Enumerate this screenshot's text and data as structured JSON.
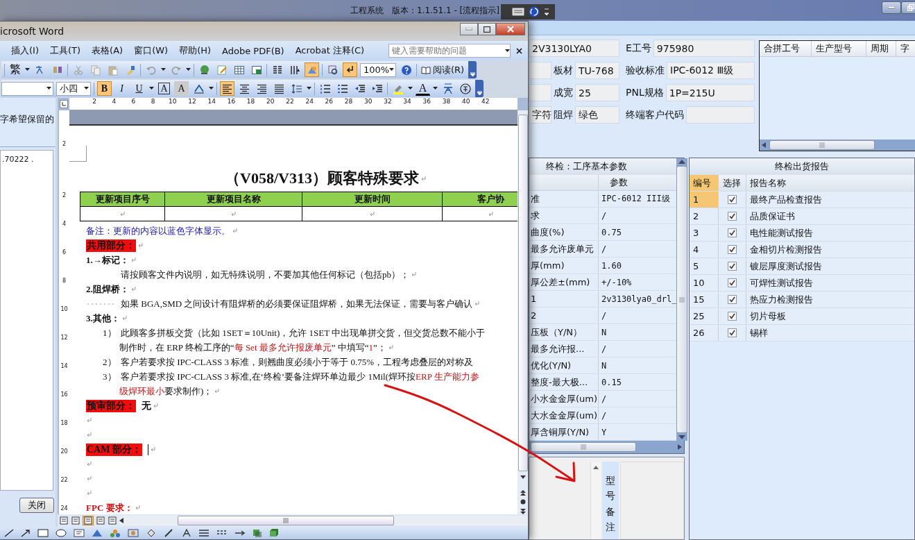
{
  "app_window": {
    "title": "工程系统　版本：1.1.51.1 - [流程指示]"
  },
  "form": {
    "left": [
      {
        "value": "2V3130LYA0"
      },
      {
        "kind": "split",
        "label": "板材",
        "value": "TU-768"
      },
      {
        "kind": "split",
        "label": "成宽",
        "value": "25"
      },
      {
        "kind": "split",
        "lead_value": "字符",
        "label": "阻焊",
        "value": "绿色"
      }
    ],
    "right": [
      {
        "label": "E工号",
        "value": "975980"
      },
      {
        "label": "验收标准",
        "value": "IPC-6012 Ⅲ级"
      },
      {
        "label": "PNL规格",
        "value": "1P=215U"
      },
      {
        "label": "终端客户代码"
      }
    ]
  },
  "merge_grid": {
    "columns": [
      "合拼工号",
      "生产型号",
      "周期",
      "字"
    ]
  },
  "params": {
    "title": "终检：工序基本参数",
    "value_column": "参数",
    "rows": [
      {
        "name": "准",
        "value": "IPC-6012 III级"
      },
      {
        "name": "求",
        "value": "/"
      },
      {
        "name": "曲度(%)",
        "value": "0.75"
      },
      {
        "name": "最多允许废单元",
        "value": "/"
      },
      {
        "name": "厚(mm)",
        "value": "1.60"
      },
      {
        "name": "厚公差±(mm)",
        "value": "+/-10%"
      },
      {
        "name": "1",
        "value": "2v3130lya0_drl_"
      },
      {
        "name": "2",
        "value": "/"
      },
      {
        "name": "压板（Y/N）",
        "value": "N"
      },
      {
        "name": "最多允许报...",
        "value": "/"
      },
      {
        "name": "优化(Y/N)",
        "value": "N"
      },
      {
        "name": "整度-最大极...",
        "value": "0.15"
      },
      {
        "name": "小水金金厚(um)",
        "value": "/"
      },
      {
        "name": "大水金金厚(um)",
        "value": "/"
      },
      {
        "name": "厚含铜厚(Y/N)",
        "value": "Y"
      }
    ]
  },
  "reports": {
    "title": "终检出货报告",
    "columns": [
      {
        "label": "编号",
        "selected": true
      },
      {
        "label": "选择",
        "selected": false
      },
      {
        "label": "报告名称",
        "selected": false
      }
    ],
    "rows": [
      {
        "no": "1",
        "checked": true,
        "name": "最终产品检查报告",
        "selected": true
      },
      {
        "no": "2",
        "checked": true,
        "name": "品质保证书",
        "selected": false
      },
      {
        "no": "3",
        "checked": true,
        "name": "电性能测试报告",
        "selected": false
      },
      {
        "no": "4",
        "checked": true,
        "name": "金相切片检测报告",
        "selected": false
      },
      {
        "no": "5",
        "checked": true,
        "name": "镀层厚度测试报告",
        "selected": false
      },
      {
        "no": "10",
        "checked": true,
        "name": "可焊性测试报告",
        "selected": false
      },
      {
        "no": "15",
        "checked": true,
        "name": "热应力检测报告",
        "selected": false
      },
      {
        "no": "25",
        "checked": true,
        "name": "切片母板",
        "selected": false
      },
      {
        "no": "26",
        "checked": true,
        "name": "锡样",
        "selected": false
      }
    ]
  },
  "memo": {
    "label": "型号备注"
  },
  "word": {
    "title": "icrosoft Word",
    "menu": [
      "插入(I)",
      "工具(T)",
      "表格(A)",
      "窗口(W)",
      "帮助(H)",
      "Adobe PDF(B)",
      "Acrobat 注释(C)"
    ],
    "help_search": {
      "placeholder": "键入需要帮助的问题"
    },
    "standard_toolbar": {
      "convert": "繁",
      "toggles": [
        {
          "kind": "drawing",
          "on": true
        },
        {
          "kind": "marks",
          "on": true
        }
      ],
      "zoom": "100%",
      "read": "阅读(R)"
    },
    "format_toolbar": {
      "font_size": "小四",
      "styles": [
        {
          "label": "B",
          "on": true
        },
        {
          "label": "I",
          "on": false
        },
        {
          "label": "U",
          "on": false
        }
      ],
      "char_buttons": [
        "A",
        "A"
      ],
      "alignments": [
        {
          "kind": "left",
          "on": true
        },
        {
          "kind": "center",
          "on": false
        },
        {
          "kind": "right",
          "on": false
        },
        {
          "kind": "justify",
          "on": false
        }
      ],
      "font_color": "A"
    },
    "task_pane": {
      "text": "字希望保留的",
      "item": ".70222 .",
      "close_button": "关闭"
    },
    "ruler": {
      "horizontal": [
        "2",
        "4",
        "6",
        "8",
        "10",
        "12",
        "14",
        "16",
        "18",
        "20",
        "22",
        "24",
        "26",
        "28",
        "30",
        "32",
        "34",
        "36",
        "38",
        "40",
        "42"
      ],
      "vertical": [
        "2",
        "2",
        "4",
        "6",
        "8",
        "10",
        "12",
        "14",
        "16",
        "18",
        "20",
        "22",
        "24"
      ]
    },
    "document": {
      "title": "（V058/V313）顾客特殊要求",
      "table": {
        "columns": [
          "更新项目序号",
          "更新项目名称",
          "更新时间",
          "客户协"
        ]
      },
      "lines": [
        {
          "kind": "note",
          "text": "备注：更新的内容以蓝色字体显示。"
        },
        {
          "kind": "section",
          "text": "共用部分："
        },
        {
          "kind": "heading",
          "text": "1.→标记："
        },
        {
          "kind": "text",
          "text": "请按顾客文件内说明，如无特殊说明，不要加其他任何标记（包括pb）；"
        },
        {
          "kind": "heading",
          "text": "2.阻焊桥："
        },
        {
          "kind": "tabbed",
          "text": "如果 BGA,SMD 之间设计有阻焊桥的必须要保证阻焊桥，如果无法保证，需要与客户确认"
        },
        {
          "kind": "heading",
          "text": "3.其他："
        },
        {
          "kind": "item",
          "marker": "1）",
          "segments": [
            {
              "text": "此顾客多拼板交货（比如 1SET＝10Unit)，允许 1SET 中出现单拼交货，但交货总数不能小于",
              "red": false
            }
          ]
        },
        {
          "kind": "cont",
          "segments": [
            {
              "text": "制作时，在 ERP 终检工序的“",
              "red": false
            },
            {
              "text": "每 Set 最多允许报废单元",
              "red": true
            },
            {
              "text": "” 中填写“",
              "red": false
            },
            {
              "text": "1",
              "red": true
            },
            {
              "text": "”；",
              "red": false
            }
          ]
        },
        {
          "kind": "item",
          "marker": "2）",
          "segments": [
            {
              "text": "客户若要求按 IPC-CLASS 3 标准，则翘曲度必须小于等于 0.75%，工程考虑叠层的对称及",
              "red": false
            }
          ]
        },
        {
          "kind": "item",
          "marker": "3）",
          "segments": [
            {
              "text": "客户若要求按 IPC-CLASS 3 标准,在‘终检’要备注焊环单边最少 1Mil(焊环按",
              "red": false
            },
            {
              "text": "ERP 生产能力参",
              "red": true
            }
          ]
        },
        {
          "kind": "cont",
          "segments": [
            {
              "text": "级焊环最小",
              "red": true
            },
            {
              "text": "要求制作)；",
              "red": false
            }
          ]
        },
        {
          "kind": "section",
          "text": "预审部分：",
          "value": "无"
        },
        {
          "kind": "empty"
        },
        {
          "kind": "empty"
        },
        {
          "kind": "section",
          "text": "CAM 部分：",
          "cursor": true
        },
        {
          "kind": "empty"
        },
        {
          "kind": "empty"
        },
        {
          "kind": "empty"
        },
        {
          "kind": "red_heading",
          "text": "FPC 要求："
        }
      ]
    }
  }
}
